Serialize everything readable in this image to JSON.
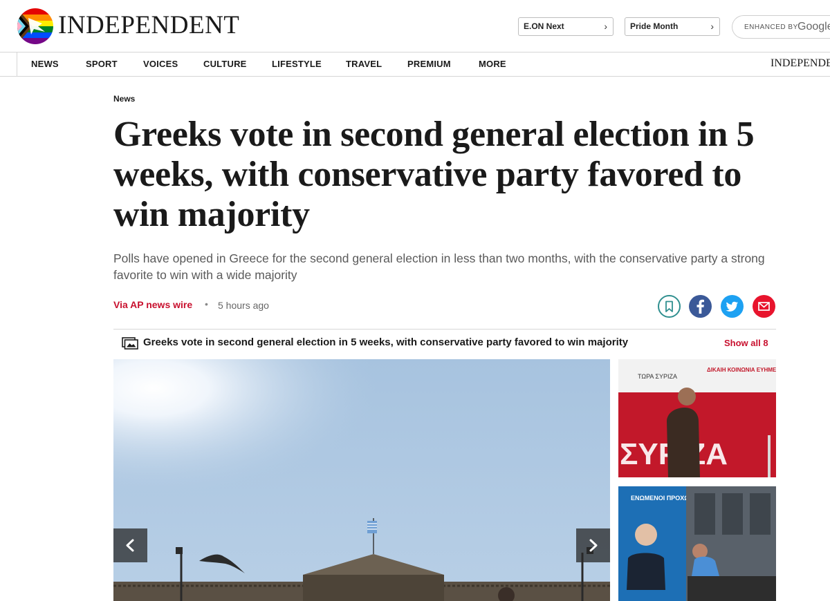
{
  "header": {
    "logo_text": "INDEPENDENT",
    "promo_pills": [
      {
        "label": "E.ON Next"
      },
      {
        "label": "Pride Month"
      }
    ],
    "search": {
      "prefix": "ENHANCED BY",
      "brand": "Google"
    }
  },
  "nav": {
    "items": [
      "NEWS",
      "SPORT",
      "VOICES",
      "CULTURE",
      "LIFESTYLE",
      "TRAVEL",
      "PREMIUM",
      "MORE"
    ],
    "brand_right": "INDEPENDENT"
  },
  "article": {
    "section": "News",
    "headline": "Greeks vote in second general election in 5 weeks, with conservative party favored to win majority",
    "standfirst": "Polls have opened in Greece for the second general election in less than two months, with the conservative party a strong favorite to win with a wide majority",
    "byline": "Via AP news wire",
    "separator": "•",
    "timestamp": "5 hours ago",
    "share_icons": [
      "bookmark-icon",
      "facebook-icon",
      "twitter-icon",
      "email-icon"
    ]
  },
  "gallery": {
    "title": "Greeks vote in second general election in 5 weeks, with conservative party favored to win majority",
    "show_all": "Show all 8",
    "thumb1_signs": {
      "left": "ΤΩΡΑ ΣΥΡΙΖΑ",
      "right": "ΔΙΚΑΙΗ ΚΟΙΝΩΝΙΑ ΕΥΗΜΕΡΙΑ ΓΙΑ ΟΛΟΥΣ",
      "big": "ΣΥΡΙΖΑ"
    },
    "thumb2_poster": "ΕΝΩΜΕΝΟΙ ΠΡΟΧΩΡΑΜΕ ΜΠΡΟΣΤΑ"
  },
  "colors": {
    "accent_red": "#c8102e",
    "facebook": "#3b5998",
    "twitter": "#1da1f2",
    "email": "#e8142d",
    "bookmark": "#2f8f8f"
  }
}
